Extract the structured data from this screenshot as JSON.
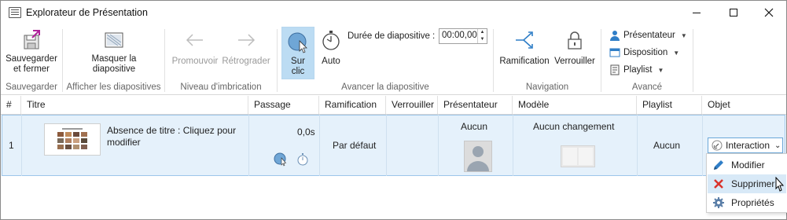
{
  "window": {
    "title": "Explorateur de Présentation"
  },
  "ribbon": {
    "save": {
      "label_line1": "Sauvegarder",
      "label_line2": "et fermer",
      "group": "Sauvegarder"
    },
    "hide": {
      "label_line1": "Masquer la",
      "label_line2": "diapositive",
      "group": "Afficher les diapositives"
    },
    "nesting": {
      "promote": "Promouvoir",
      "demote": "Rétrograder",
      "group": "Niveau d'imbrication"
    },
    "advance": {
      "on_click_line1": "Sur",
      "on_click_line2": "clic",
      "auto": "Auto",
      "duration_label": "Durée de diapositive :",
      "duration_value": "00:00,00",
      "group": "Avancer la diapositive"
    },
    "navigation": {
      "branching": "Ramification",
      "lock": "Verrouiller",
      "group": "Navigation"
    },
    "advanced": {
      "presenter": "Présentateur",
      "layout": "Disposition",
      "playlist": "Playlist",
      "group": "Avancé"
    }
  },
  "table": {
    "headers": [
      "#",
      "Titre",
      "Passage",
      "Ramification",
      "Verrouiller",
      "Présentateur",
      "Modèle",
      "Playlist",
      "Objet"
    ],
    "rows": [
      {
        "index": "1",
        "title_line1": "Absence de titre : Cliquez pour",
        "title_line2": "modifier",
        "passage_time": "0,0s",
        "branching": "Par défaut",
        "presenter": "Aucun",
        "layout": "Aucun changement",
        "playlist": "Aucun",
        "object": "Interaction"
      }
    ]
  },
  "context_menu": {
    "items": [
      "Modifier",
      "Supprimer",
      "Propriétés"
    ]
  },
  "colors": {
    "selection_bg": "#e5f1fb",
    "active_button_bg": "#bcdcf3",
    "accent": "#2f7ec7",
    "delete_red": "#d9322b"
  }
}
